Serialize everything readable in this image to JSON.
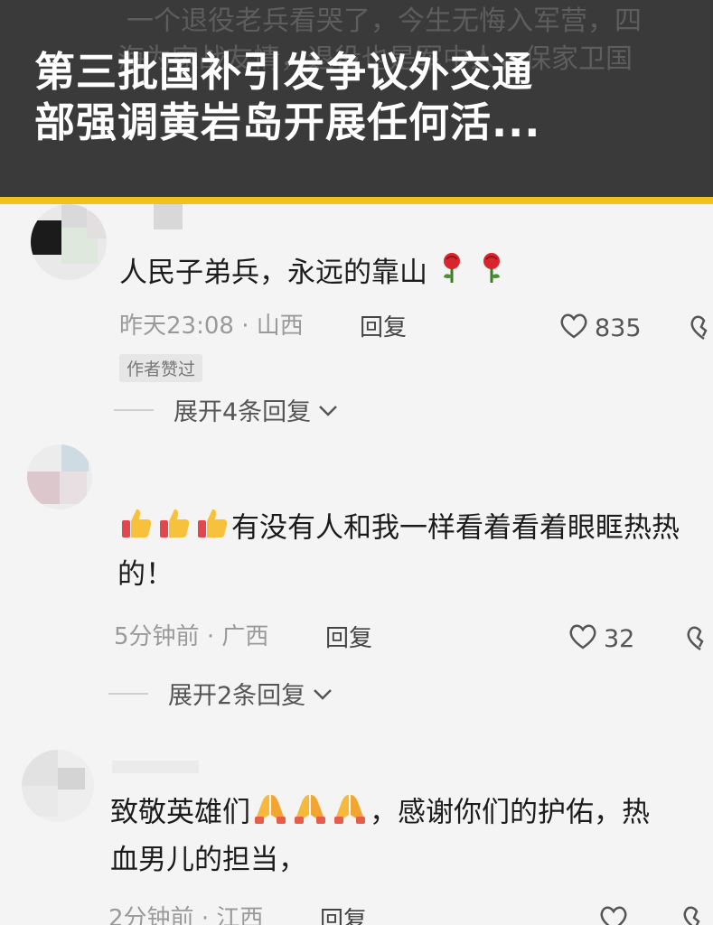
{
  "banner": {
    "ghost_line_1": "一个退役老兵看哭了，今生无悔入军营，四",
    "ghost_line_2": "海为家战友情，退役也是军中人，保家卫国",
    "headline_line_1": "第三批国补引发争议外交通",
    "headline_line_2": "部强调黄岩岛开展任何活..."
  },
  "comments": [
    {
      "text": "人民子弟兵，永远的靠山",
      "emoji": "rose",
      "emoji_count": 2,
      "time": "昨天23:08",
      "region": "山西",
      "reply_label": "回复",
      "likes": "835",
      "author_liked": "作者赞过",
      "expand_label": "展开4条回复"
    },
    {
      "text": "有没有人和我一样看着看着眼眶热热的！",
      "emoji": "thumbs-up",
      "emoji_count": 3,
      "time": "5分钟前",
      "region": "广西",
      "reply_label": "回复",
      "likes": "32",
      "expand_label": "展开2条回复"
    },
    {
      "text_line_1": "致敬英雄们",
      "text_line_1b": "，感谢你们的护佑，热",
      "text_line_2": "血男儿的担当，",
      "emoji": "folded-hands",
      "emoji_count": 3,
      "time": "2分钟前",
      "region": "江西",
      "reply_label": "回复"
    }
  ],
  "colors": {
    "banner_bg": "#3a3a3a",
    "stripe": "#f1c21b",
    "meta_text": "#9a9a9a"
  },
  "separator": "·"
}
